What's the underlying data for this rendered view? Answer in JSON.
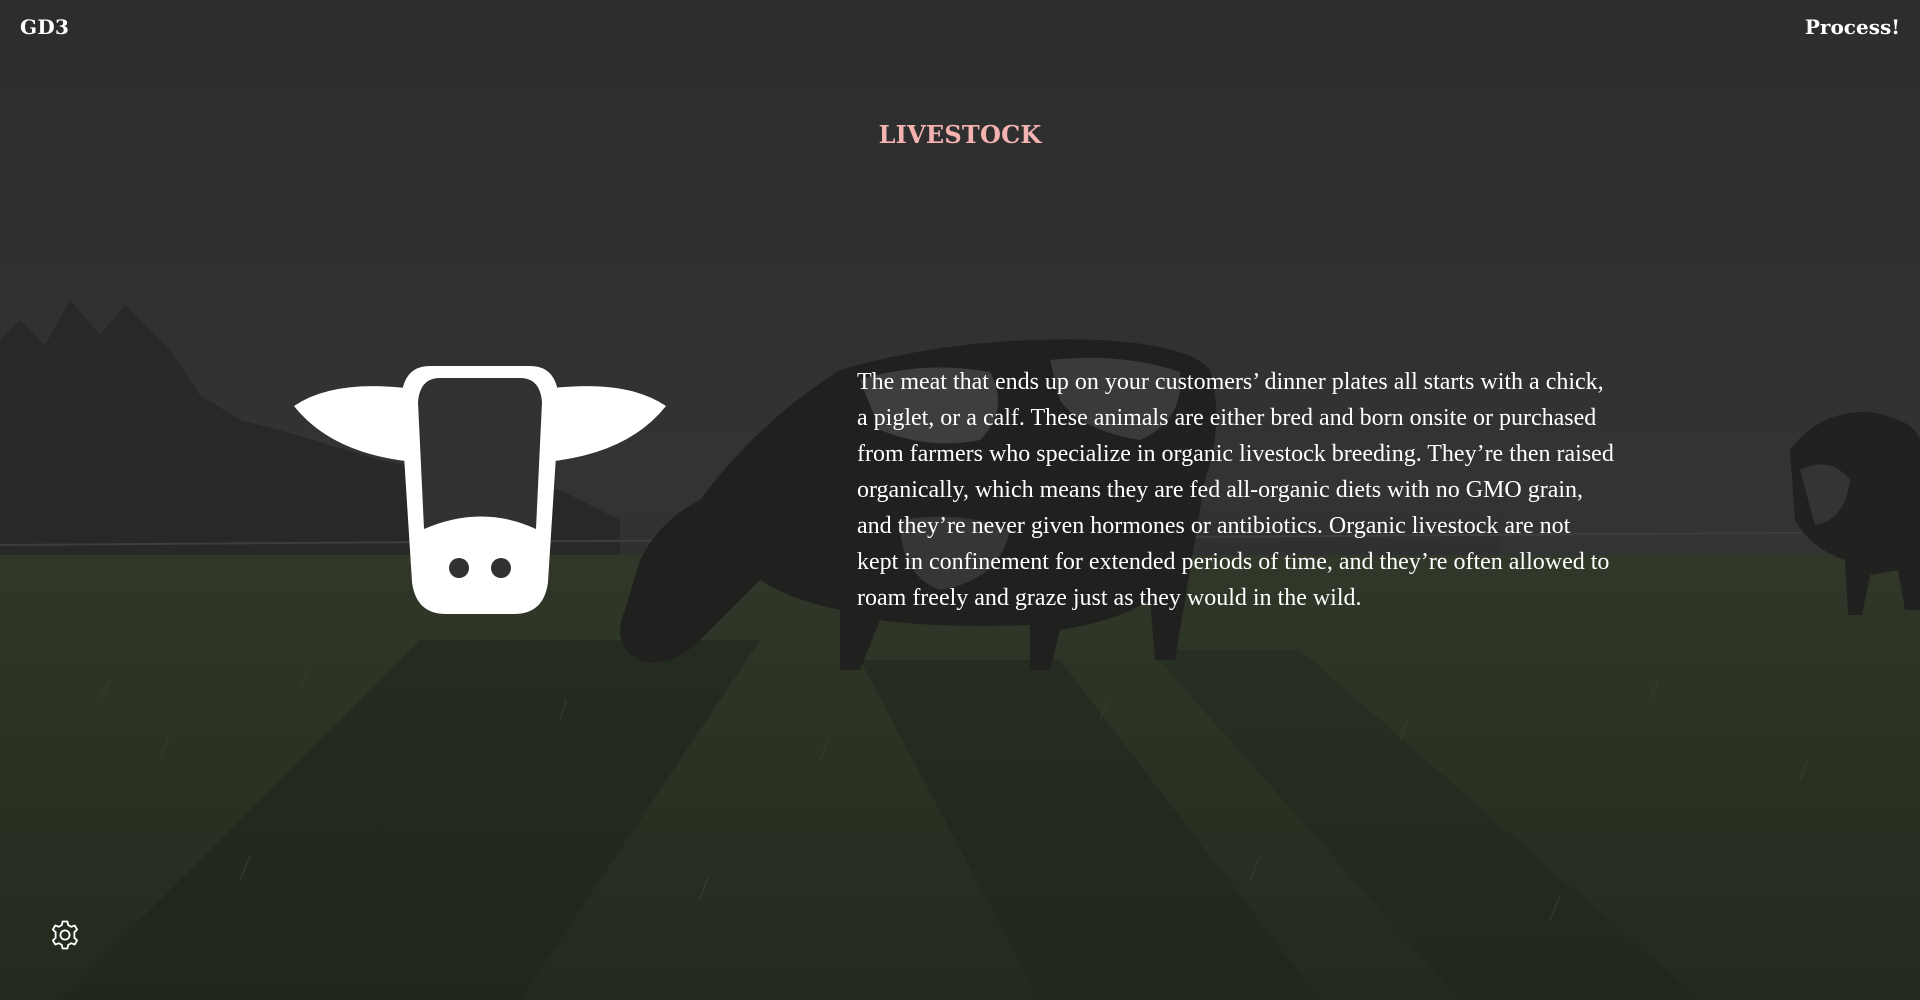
{
  "header": {
    "brand": "GD3",
    "process_link": "Process!"
  },
  "section": {
    "title": "LIVESTOCK",
    "body": "The meat that ends up on your customers’ dinner plates all starts with a chick, a piglet, or a calf. These animals are either bred and born onsite or purchased from farmers who specialize in organic livestock breeding. They’re then raised organically, which means they are fed all-organic diets with no GMO grain, and they’re never given hormones or antibiotics. Organic livestock are not kept in confinement for extended periods of time, and they’re often allowed to roam freely and graze just as they would in the wild.",
    "icon": "cow-head-icon"
  },
  "footer": {
    "settings_icon": "gear-icon"
  },
  "colors": {
    "title": "#f4b3b0",
    "text": "#ffffff",
    "overlay": "#2b2d2c"
  }
}
